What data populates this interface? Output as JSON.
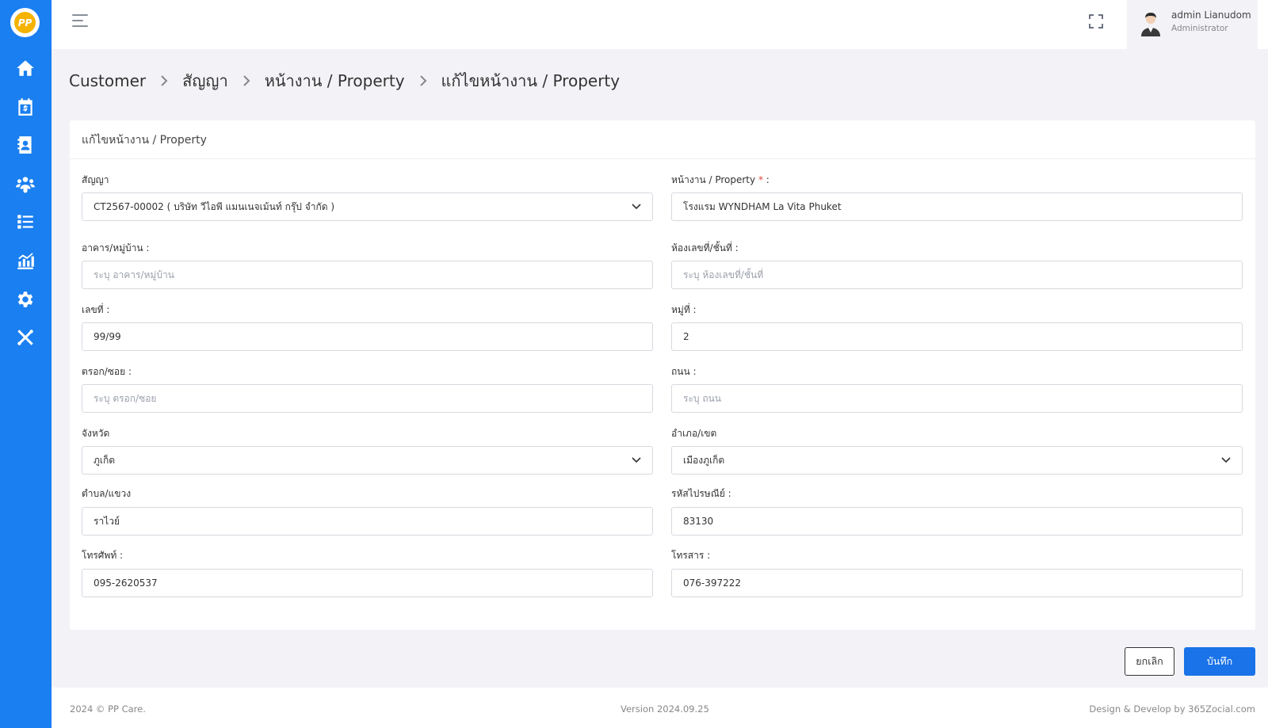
{
  "app": {
    "logo_text": "PP"
  },
  "sidebar": {
    "items": [
      {
        "icon": "home-icon"
      },
      {
        "icon": "calendar-payment-icon"
      },
      {
        "icon": "contact-book-icon",
        "active": true
      },
      {
        "icon": "users-gear-icon"
      },
      {
        "icon": "list-icon"
      },
      {
        "icon": "chart-icon"
      },
      {
        "icon": "gear-icon"
      },
      {
        "icon": "tools-icon"
      }
    ]
  },
  "user": {
    "name": "admin Lianudom",
    "role": "Administrator"
  },
  "breadcrumb": [
    "Customer",
    "สัญญา",
    "หน้างาน / Property",
    "แก้ไขหน้างาน / Property"
  ],
  "card": {
    "title": "แก้ไขหน้างาน / Property"
  },
  "form": {
    "contract": {
      "label": "สัญญา",
      "value": "CT2567-00002 ( บริษัท วีไอพี แมนเนจเม้นท์ กรุ๊ป จำกัด )"
    },
    "property": {
      "label": "หน้างาน / Property",
      "required": "*",
      "colon": " :",
      "value": "โรงแรม WYNDHAM La Vita Phuket"
    },
    "building": {
      "label": "อาคาร/หมู่บ้าน :",
      "placeholder": "ระบุ อาคาร/หมู่บ้าน"
    },
    "room": {
      "label": "ห้องเลขที่/ชั้นที่ :",
      "placeholder": "ระบุ ห้องเลขที่/ชั้นที่"
    },
    "house_no": {
      "label": "เลขที่ :",
      "value": "99/99"
    },
    "moo": {
      "label": "หมู่ที่ :",
      "value": "2"
    },
    "soi": {
      "label": "ตรอก/ซอย :",
      "placeholder": "ระบุ ตรอก/ซอย"
    },
    "road": {
      "label": "ถนน :",
      "placeholder": "ระบุ ถนน"
    },
    "province": {
      "label": "จังหวัด",
      "value": "ภูเก็ต"
    },
    "district": {
      "label": "อำเภอ/เขต",
      "value": "เมืองภูเก็ต"
    },
    "subdistrict": {
      "label": "ตำบล/แขวง",
      "value": "ราไวย์"
    },
    "postcode": {
      "label": "รหัสไปรษณีย์ :",
      "value": "83130"
    },
    "phone": {
      "label": "โทรศัพท์ :",
      "value": "095-2620537"
    },
    "fax": {
      "label": "โทรสาร :",
      "value": "076-397222"
    }
  },
  "buttons": {
    "cancel": "ยกเลิก",
    "save": "บันทึก"
  },
  "footer": {
    "copyright": "2024 © PP Care.",
    "version": "Version 2024.09.25",
    "credit": "Design & Develop by 365Zocial.com"
  },
  "colors": {
    "sidebar": "#1a7ff0",
    "primary": "#1a73e8",
    "required": "#e0453b"
  }
}
